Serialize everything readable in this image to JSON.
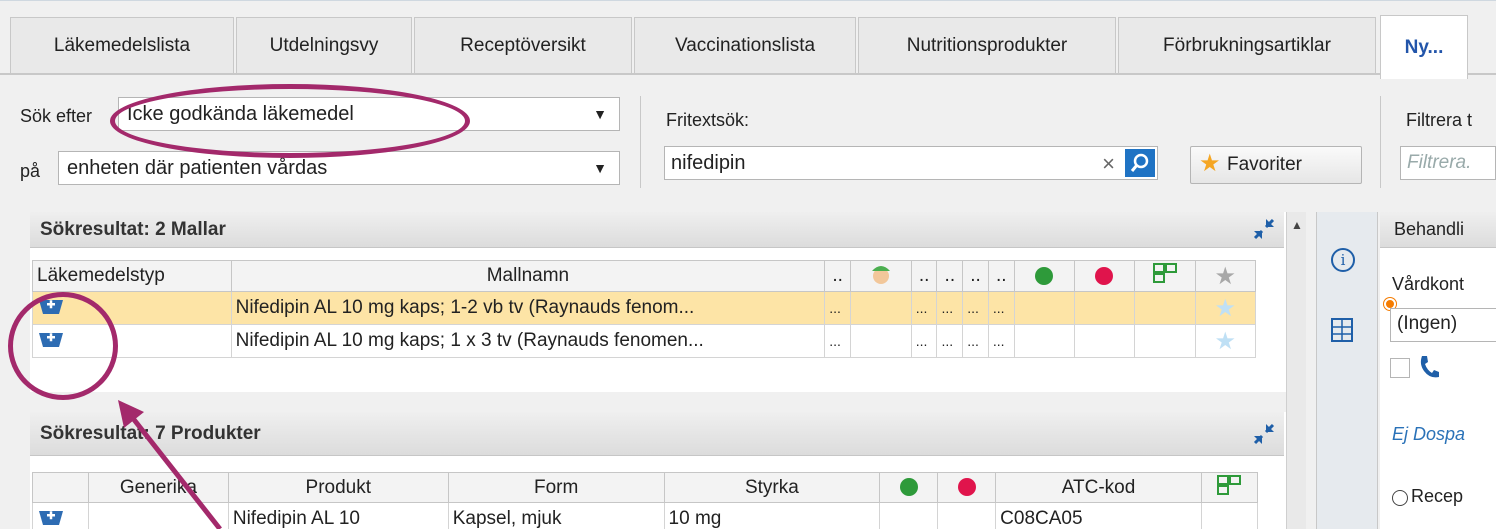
{
  "tabs": [
    {
      "label": "Läkemedelslista"
    },
    {
      "label": "Utdelningsvy"
    },
    {
      "label": "Receptöversikt"
    },
    {
      "label": "Vaccinationslista"
    },
    {
      "label": "Nutritionsprodukter"
    },
    {
      "label": "Förbrukningsartiklar"
    },
    {
      "label": "Ny..."
    }
  ],
  "search": {
    "sok_efter_label": "Sök efter",
    "sok_efter_value": "Icke godkända läkemedel",
    "pa_label": "på",
    "pa_value": "enheten där patienten vårdas",
    "fritext_label": "Fritextsök:",
    "fritext_value": "nifedipin",
    "favoriter_label": "Favoriter",
    "filtrera_label": "Filtrera t",
    "filtrera_placeholder": "Filtrera."
  },
  "mallar": {
    "title": "Sökresultat: 2 Mallar",
    "columns": [
      "Läkemedelstyp",
      "Mallnamn",
      "..",
      "",
      "..",
      "..",
      "..",
      "..",
      "",
      "",
      "",
      ""
    ],
    "rows": [
      {
        "mallnamn": "Nifedipin AL 10 mg kaps; 1-2 vb tv (Raynauds fenom...",
        "c1": "...",
        "c3": "...",
        "c4": "...",
        "c5": "...",
        "c6": "..."
      },
      {
        "mallnamn": "Nifedipin AL 10 mg kaps; 1 x 3 tv (Raynauds fenomen...",
        "c1": "...",
        "c3": "...",
        "c4": "...",
        "c5": "...",
        "c6": "..."
      }
    ]
  },
  "produkter": {
    "title": "Sökresultat: 7 Produkter",
    "columns": [
      "",
      "Generika",
      "Produkt",
      "Form",
      "Styrka",
      "",
      "",
      "ATC-kod",
      ""
    ],
    "rows": [
      {
        "generika": "",
        "produkt": "Nifedipin AL 10",
        "form": "Kapsel, mjuk",
        "styrka": "10 mg",
        "atc": "C08CA05"
      }
    ]
  },
  "right_panel": {
    "header": "Behandli",
    "vardkont_label": "Vårdkont",
    "vardkont_value": "(Ingen)",
    "ej_dospa": "Ej Dospa",
    "recept_label": "Recep"
  },
  "colors": {
    "accent": "#1f73c4",
    "highlight_row": "#fde4a6",
    "annotation": "#a3296b",
    "green_dot": "#2e9a3a",
    "red_dot": "#e0144c"
  }
}
